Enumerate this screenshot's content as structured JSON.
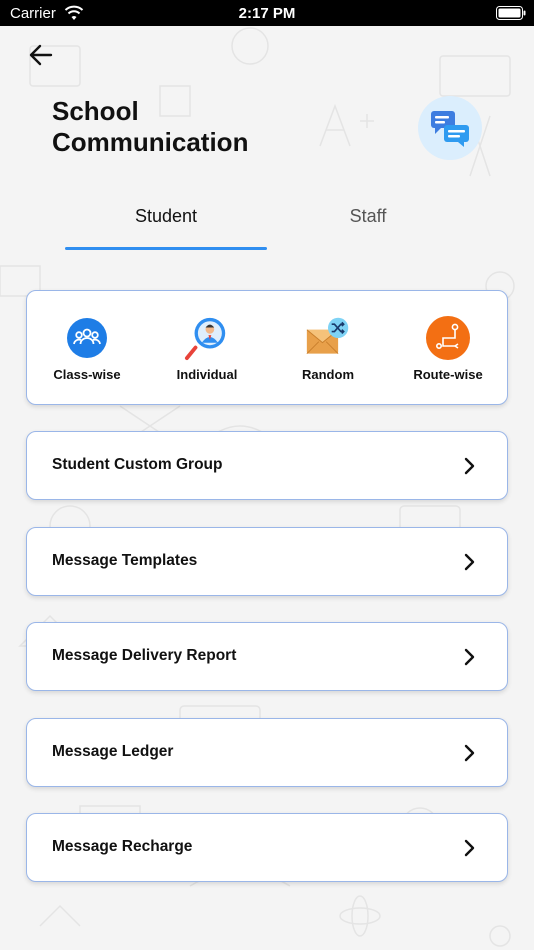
{
  "status_bar": {
    "carrier": "Carrier",
    "time": "2:17 PM"
  },
  "header": {
    "title_line1": "School",
    "title_line2": "Communication"
  },
  "tabs": [
    {
      "label": "Student",
      "selected": true
    },
    {
      "label": "Staff",
      "selected": false
    }
  ],
  "categories": [
    {
      "label": "Class-wise",
      "icon": "group-icon",
      "color": "#1e7de6"
    },
    {
      "label": "Individual",
      "icon": "person-search-icon",
      "color": "#2f8ef0"
    },
    {
      "label": "Random",
      "icon": "envelope-shuffle-icon",
      "color": "#e8a04a"
    },
    {
      "label": "Route-wise",
      "icon": "route-icon",
      "color": "#f36f13"
    }
  ],
  "menu": [
    {
      "label": "Student Custom Group"
    },
    {
      "label": "Message Templates"
    },
    {
      "label": "Message Delivery Report"
    },
    {
      "label": "Message Ledger"
    },
    {
      "label": "Message Recharge"
    }
  ],
  "colors": {
    "accent": "#2f8ef0",
    "card_border": "#9ab6e8",
    "background": "#f4f4f4"
  }
}
